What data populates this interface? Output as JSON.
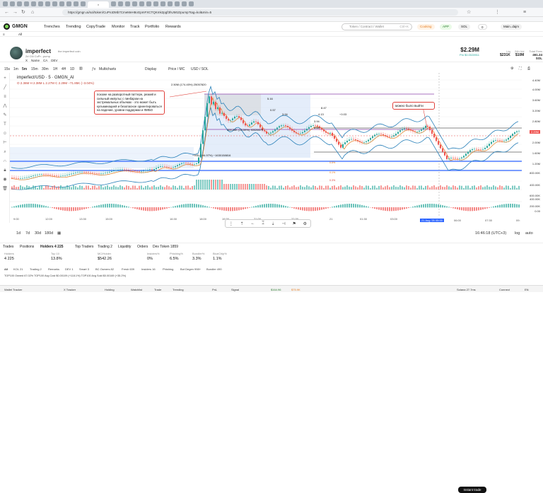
{
  "browser": {
    "url": "https://gmgn.ai/sol/token/CuProDMb7CmeMeH8oGpmFXCTQKmk2pgf3hUM1Dpump?tag=kol&min=5",
    "url_prefix": "gmgn.ai"
  },
  "app": {
    "brand": "GMGN",
    "nav": [
      "Trenches",
      "Trending",
      "CopyTrade",
      "Monitor",
      "Track",
      "Portfolio",
      "Rewards"
    ],
    "search_placeholder": "Token / Contract / Wallet",
    "search_hint": "Ctrl+K",
    "cooking": "Cooking",
    "app_label": "APP",
    "chain": "SOL",
    "sol_balance": "0",
    "account": "Main..dajm",
    "sub_all": "All"
  },
  "token": {
    "symbol": "imperfect",
    "fullname": "the imperfect coin",
    "age": "2d",
    "creator_tag": "C6i CuPr...pump",
    "buttons": [
      "X",
      "Name",
      "CA",
      "DEV"
    ],
    "price": "$2.29M",
    "price_change": "Pm $0.0028911",
    "liq_label": "Liq",
    "liq": "$231K",
    "vol_label": "24h Vol",
    "vol": "$10M",
    "supply_label": "Total Fees",
    "supply": "461.24 SOL"
  },
  "toolbar": {
    "timeframes": [
      "15s",
      "1m",
      "5m",
      "15m",
      "30m",
      "1H",
      "4H",
      "1D"
    ],
    "multicharts": "Multicharts",
    "display": "Display",
    "price_mc": "Price / MC",
    "usd_sol": "USD / SOL"
  },
  "chart_legend": {
    "title": "imperfect/USD · 5 · GMGN_AI",
    "ohlc": "O 2.36M  H 2.38M  L 2.27M  C 2.29M  −71.85K (−3.04%)"
  },
  "annotations": {
    "left": "похоже на разворотный паттерн, резкий и сильный импульс с пинбаром на экстремальных объемах - это может быть кульминацией и безопасное ориентироваться на падение, уровни поддержки и ФИБО",
    "right": "можно было выйти"
  },
  "price_labels": [
    "4.40M",
    "4.00M",
    "3.60M",
    "3.20M",
    "2.80M",
    "2.40M",
    "2.00M",
    "1.60M",
    "1.20M",
    "800.00K",
    "400.00K",
    "600.00K",
    "400.00K",
    "200.00K",
    "0.00"
  ],
  "tag_labels": {
    "current": "2.29M",
    "current_time": "03:47",
    "low_tag": "1.76M"
  },
  "measure_labels": {
    "top": "2.50M (174.45%) 25057820",
    "mid": "300.26K (15.59%) 30026679",
    "neg": "−935 (−46.97%) −1630158816",
    "fib": [
      "5.16",
      "0.57",
      "8.47",
      "3.94",
      "4.13",
      "3.94",
      "−0.03",
      "2.94"
    ],
    "fib_small": [
      "0.5%",
      "0.1%",
      "0.3%"
    ]
  },
  "time_labels": [
    "9:00",
    "12:00",
    "13:30",
    "15:00",
    "16:30",
    "18:00",
    "19:30",
    "21:00",
    "22:30",
    "21",
    "01:30",
    "03:00",
    "21 Aug '25  05:00",
    "06:00",
    "07:30",
    "09:"
  ],
  "tf_bottom": [
    "1d",
    "7d",
    "30d",
    "180d"
  ],
  "clock": "16:46:18 (UTC+3)",
  "log_toggle": "log",
  "auto_toggle": "auto",
  "bottom_tabs": [
    "Trades",
    "Positions",
    "Holders 4 225",
    "Top Traders",
    "Trading 2",
    "Liquidity",
    "Orders",
    "Dev Token 1859"
  ],
  "instant_trade": "Instant trade",
  "stats": [
    {
      "k": "Holders",
      "v": "4 225"
    },
    {
      "k": "Top 10",
      "v": "13.8%"
    },
    {
      "k": "MC/Holder",
      "v": "$542.26"
    },
    {
      "k": "Insiders%",
      "v": "0%"
    },
    {
      "k": "Phishing%",
      "v": "6.5%"
    },
    {
      "k": "Bundler%",
      "v": "3.3%"
    },
    {
      "k": "BlueChip%",
      "v": "1.1%"
    }
  ],
  "filters": [
    "All",
    "KOL 21",
    "Trading 2",
    "Remarks",
    "DEV 1",
    "Smart 3",
    "BC Owners 82",
    "Fresh 639",
    "Insiders 16",
    "Phishing",
    "Bot Degen 998+",
    "Bundler 490"
  ],
  "owners": "TOP100 Owned 67.02%  TOP100 Avg Cost $0.00109 (+118.1%)  TOP100 Avg Sold $0.00169 (+35.2%)",
  "bottom_status": {
    "items": [
      "Wallet Tracker",
      "X Tracker",
      "Holding",
      "Watchlist",
      "Trade",
      "Trending",
      "PnL",
      "Signal"
    ],
    "sol_price": "$164.96",
    "bnb_price": "$75.9K",
    "network": "Solana 27.7ms",
    "connect": "Connect",
    "lang": "EN"
  },
  "colors": {
    "up": "#26a69a",
    "down": "#ef5350",
    "accent": "#e0413b",
    "blue_band": "#2962ff",
    "purple_line": "#8e44ad"
  }
}
